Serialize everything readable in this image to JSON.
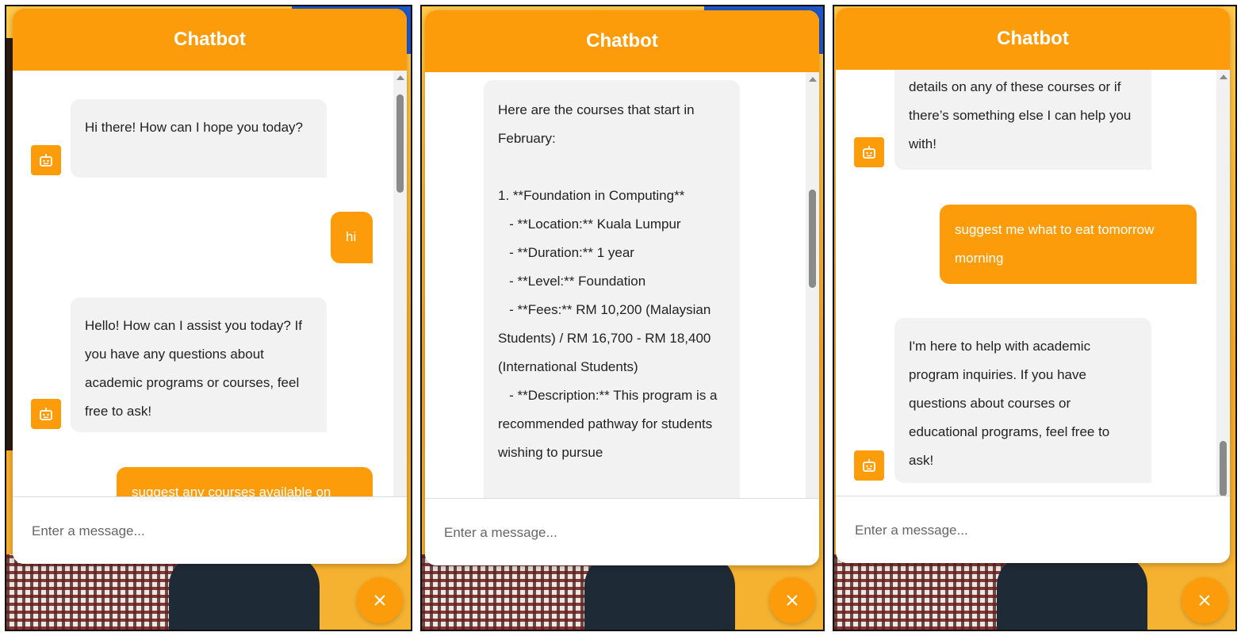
{
  "accent": "#fd9c0b",
  "icons": {
    "bot": "robot-icon",
    "close": "close-icon",
    "scroll_up": "chevron-up-icon"
  },
  "panels": [
    {
      "title": "Chatbot",
      "input_placeholder": "Enter a message...",
      "messages": [
        {
          "role": "bot",
          "text": "Hi there! How can I hope you today?"
        },
        {
          "role": "user",
          "text": "hi"
        },
        {
          "role": "bot",
          "text": "Hello! How can I assist you today? If you have any questions about academic programs or courses, feel free to ask!"
        },
        {
          "role": "user",
          "text": "suggest any courses available on"
        }
      ]
    },
    {
      "title": "Chatbot",
      "input_placeholder": "Enter a message...",
      "messages": [
        {
          "role": "bot",
          "text": "Here are the courses that start in February:\n\n1. **Foundation in Computing**\n   - **Location:** Kuala Lumpur\n   - **Duration:** 1 year\n   - **Level:** Foundation\n   - **Fees:** RM 10,200 (Malaysian Students) / RM 16,700 - RM 18,400 (International Students)\n   - **Description:** This program is a recommended pathway for students wishing to pursue"
        }
      ]
    },
    {
      "title": "Chatbot",
      "input_placeholder": "Enter a message...",
      "messages": [
        {
          "role": "bot",
          "text": "details on any of these courses or if there’s something else I can help you with!"
        },
        {
          "role": "user",
          "text": "suggest me what to eat tomorrow morning"
        },
        {
          "role": "bot",
          "text": "I'm here to help with academic program inquiries. If you have questions about courses or educational programs, feel free to ask!"
        }
      ]
    }
  ]
}
